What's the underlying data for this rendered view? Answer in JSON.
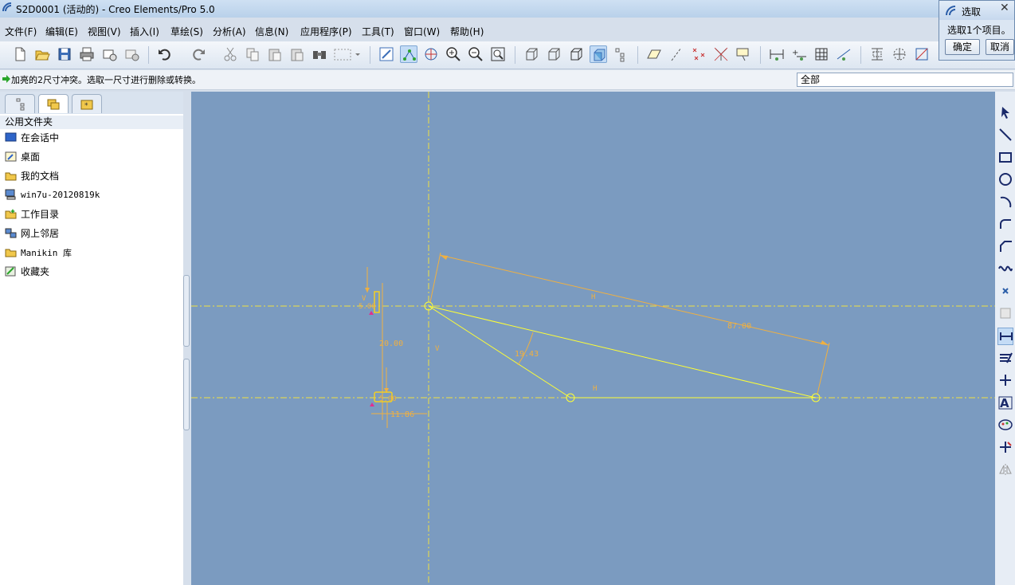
{
  "window": {
    "title": "S2D0001 (活动的) - Creo Elements/Pro 5.0"
  },
  "menu": [
    "文件(F)",
    "编辑(E)",
    "视图(V)",
    "插入(I)",
    "草绘(S)",
    "分析(A)",
    "信息(N)",
    "应用程序(P)",
    "工具(T)",
    "窗口(W)",
    "帮助(H)"
  ],
  "message": "加亮的2尺寸冲突。选取一尺寸进行删除或转换。",
  "filter": {
    "value": "全部"
  },
  "navigator": {
    "folder_header": "公用文件夹",
    "items": [
      "在会话中",
      "桌面",
      "我的文档",
      "win7u-20120819k",
      "工作目录",
      "网上邻居",
      "Manikin 库",
      "收藏夹"
    ]
  },
  "select_dialog": {
    "title": "选取",
    "prompt": "选取1个项目。",
    "ok": "确定",
    "cancel": "取消"
  },
  "sketch": {
    "colors": {
      "canvas": "#7b9bc0",
      "geometry": "#ffff33",
      "dimension": "#f0b040",
      "conflict_highlight": "#f5d020"
    },
    "dims": {
      "long": "87.00",
      "angle": "19.43",
      "vertical": "20.00",
      "small_v": "5.00",
      "small_w": "5.00",
      "offset": "11.86"
    },
    "constraint_labels": {
      "h_top": "H",
      "h_bottom": "H",
      "v_left": "V",
      "v_small": "V"
    }
  }
}
